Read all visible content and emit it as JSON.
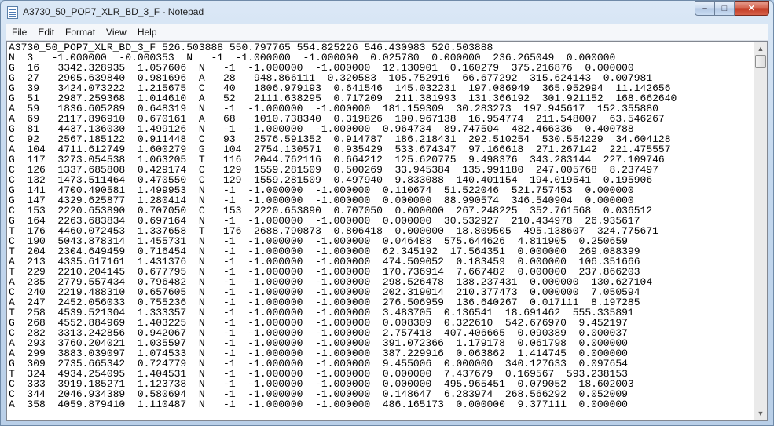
{
  "window": {
    "title": "A3730_50_POP7_XLR_BD_3_F - Notepad",
    "controls": {
      "minimize": "–",
      "maximize": "□",
      "close": "✕"
    }
  },
  "menu": [
    "File",
    "Edit",
    "Format",
    "View",
    "Help"
  ],
  "scrollbar": {
    "up_arrow": "▲",
    "down_arrow": "▼"
  },
  "content": {
    "lines": [
      "A3730_50_POP7_XLR_BD_3_F 526.503888 550.797765 554.825226 546.430983 526.503888",
      "N  3   -1.000000  -0.000353  N   -1  -1.000000  -1.000000  0.025780  0.000000  236.265049  0.000000",
      "G  16   3342.328935  1.057606  N   -1  -1.000000  -1.000000  12.130901  0.160279  375.216876  0.000000",
      "G  27   2905.639840  0.981696  A   28   948.866111  0.320583  105.752916  66.677292  315.624143  0.007981",
      "G  39   3424.073222  1.215675  C   40   1806.979193  0.641546  145.032231  197.086949  365.952994  11.142656",
      "G  51   2987.259368  1.014610  A   52   2111.638295  0.717209  211.381993  131.366192  301.921152  168.662640",
      "A  59   1836.605289  0.648319  N   -1  -1.000000  -1.000000  181.159309  30.283273  197.945617  152.355880",
      "A  69   2117.896910  0.670161  A   68   1010.738340  0.319826  100.967138  16.954774  211.548007  63.546267",
      "G  81   4437.136030  1.499126  N   -1  -1.000000  -1.000000  0.964734  89.747504  482.466336  0.400788",
      "C  92   2567.185122  0.911448  C   93   2576.591352  0.914787  186.218431  292.510254  530.554229  34.604128",
      "A  104  4711.612749  1.600279  G   104  2754.130571  0.935429  533.674347  97.166618  271.267142  221.475557",
      "G  117  3273.054538  1.063205  T   116  2044.762116  0.664212  125.620775  9.498376  343.283144  227.109746",
      "C  126  1337.685808  0.429174  C   129  1559.281509  0.500269  33.945384  135.991180  247.005768  8.237497",
      "C  132  1473.511464  0.470550  C   129  1559.281509  0.497940  9.833088  140.401154  194.019541  0.195906",
      "G  141  4700.490581  1.499953  N   -1  -1.000000  -1.000000  0.110674  51.522046  521.757453  0.000000",
      "G  147  4329.625877  1.280414  N   -1  -1.000000  -1.000000  0.000000  88.990574  346.540904  0.000000",
      "C  153  2220.653890  0.707050  C   153  2220.653890  0.707050  0.000000  267.248225  352.761568  0.036512",
      "G  164  2263.683834  0.697164  N   -1  -1.000000  -1.000000  0.000000  30.532927  210.434978  26.935617",
      "T  176  4460.072453  1.337658  T   176  2688.790873  0.806418  0.000000  18.809505  495.138607  324.775671",
      "C  190  5043.878314  1.455731  N   -1  -1.000000  -1.000000  0.046488  575.644626  4.811905  0.250659",
      "T  204  2304.649459  0.716454  N   -1  -1.000000  -1.000000  62.345192  17.564351  0.000000  269.088399",
      "A  213  4335.617161  1.431376  N   -1  -1.000000  -1.000000  474.509052  0.183459  0.000000  106.351666",
      "T  229  2210.204145  0.677795  N   -1  -1.000000  -1.000000  170.736914  7.667482  0.000000  237.866203",
      "A  235  2779.557434  0.796482  N   -1  -1.000000  -1.000000  298.526478  138.237431  0.000000  130.627104",
      "C  240  2219.488310  0.657605  N   -1  -1.000000  -1.000000  202.319014  210.377473  0.000000  7.050594",
      "A  247  2452.056033  0.755236  N   -1  -1.000000  -1.000000  276.506959  136.640267  0.017111  8.197285",
      "T  258  4539.521304  1.333357  N   -1  -1.000000  -1.000000  3.483705  0.136541  18.691462  555.335891",
      "G  268  4552.884969  1.403225  N   -1  -1.000000  -1.000000  0.008309  0.322610  542.676970  9.452197",
      "C  282  3313.242856  0.942067  N   -1  -1.000000  -1.000000  2.757418  407.406665  0.090389  0.000037",
      "A  293  3760.204021  1.035597  N   -1  -1.000000  -1.000000  391.072366  1.179178  0.061798  0.000000",
      "A  299  3883.039097  1.074533  N   -1  -1.000000  -1.000000  387.229916  0.063862  1.414745  0.000000",
      "G  309  2735.665342  0.724779  N   -1  -1.000000  -1.000000  9.455006  0.000000  340.127633  0.097654",
      "T  324  4934.254095  1.404531  N   -1  -1.000000  -1.000000  0.000000  7.437679  0.169567  593.238153",
      "C  333  3919.185271  1.123738  N   -1  -1.000000  -1.000000  0.000000  495.965451  0.079052  18.602003",
      "C  344  2046.934389  0.580694  N   -1  -1.000000  -1.000000  0.148647  6.283974  268.566292  0.052009",
      "A  358  4059.879410  1.110487  N   -1  -1.000000  -1.000000  486.165173  0.000000  9.377111  0.000000"
    ]
  }
}
